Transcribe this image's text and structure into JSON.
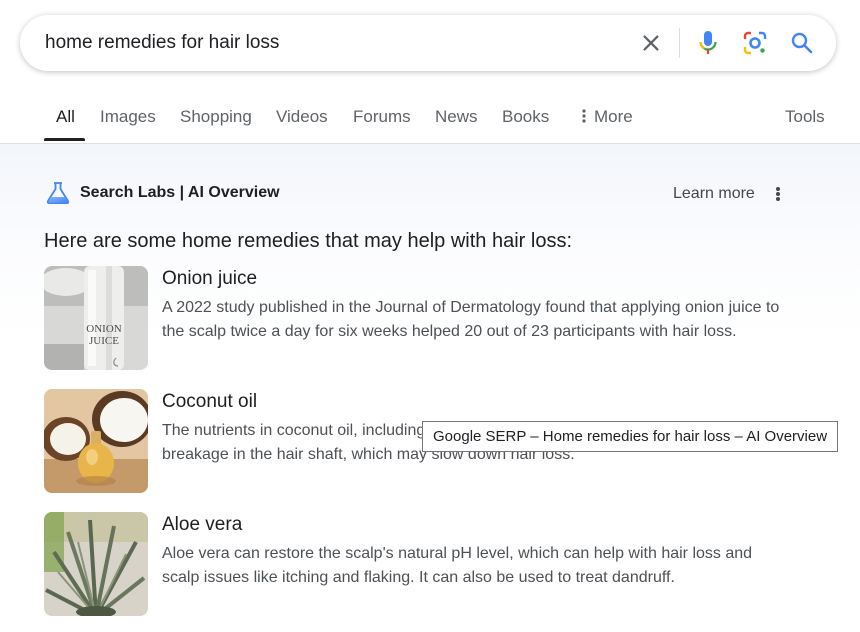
{
  "search": {
    "query": "home remedies for hair loss",
    "icons": [
      "clear-icon",
      "microphone-icon",
      "lens-icon",
      "search-icon"
    ]
  },
  "tabs": [
    {
      "label": "All",
      "active": true
    },
    {
      "label": "Images"
    },
    {
      "label": "Shopping"
    },
    {
      "label": "Videos"
    },
    {
      "label": "Forums"
    },
    {
      "label": "News"
    },
    {
      "label": "Books"
    },
    {
      "label": "More"
    }
  ],
  "tools_label": "Tools",
  "overview": {
    "header": "Search Labs | AI Overview",
    "learn_more": "Learn more",
    "intro": "Here are some home remedies that may help with hair loss:",
    "items": [
      {
        "title": "Onion juice",
        "description": "A 2022 study published in the Journal of Dermatology found that applying onion juice to the scalp twice a day for six weeks helped 20 out of 23 participants with hair loss.",
        "image_label": "ONION JUICE"
      },
      {
        "title": "Coconut oil",
        "description": "The nutrients in coconut oil, including lauric acid, may help reduce protein loss and breakage in the hair shaft, which may slow down hair loss."
      },
      {
        "title": "Aloe vera",
        "description": "Aloe vera can restore the scalp's natural pH level, which can help with hair loss and scalp issues like itching and flaking. It can also be used to treat dandruff."
      }
    ]
  },
  "tooltip": "Google SERP – Home remedies for hair loss – AI Overview",
  "colors": {
    "google_blue": "#4285f4",
    "google_red": "#ea4335",
    "google_yellow": "#fbbc04",
    "google_green": "#34a853"
  }
}
